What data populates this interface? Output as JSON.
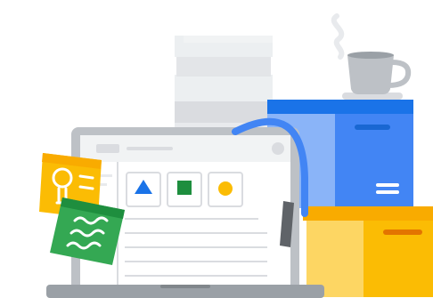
{
  "illustration": {
    "colors": {
      "paper": "#eceff1",
      "paper_shadow": "#dadce0",
      "laptop_body": "#bdc1c6",
      "laptop_screen": "#ffffff",
      "laptop_base": "#9aa0a6",
      "ui_line": "#dadce0",
      "blue_box_front": "#4285f4",
      "blue_box_top": "#1a73e8",
      "blue_box_side": "#8ab4f8",
      "yellow_box_front": "#fbbc04",
      "yellow_box_top": "#f9ab00",
      "yellow_box_side": "#fdd663",
      "headset_band": "#4285f4",
      "headset_pad": "#5f6368",
      "mug": "#bdc1c6",
      "steam": "#e8eaed",
      "sticky_yellow": "#fbbc04",
      "sticky_green": "#34a853",
      "triangle": "#1a73e8",
      "square": "#1e8e3e",
      "circle": "#fbbc04"
    },
    "icons": {
      "lightbulb": "lightbulb-icon",
      "wave_lines": "wave-lines-icon",
      "triangle": "triangle-shape-icon",
      "square": "square-shape-icon",
      "circle": "circle-shape-icon"
    }
  }
}
